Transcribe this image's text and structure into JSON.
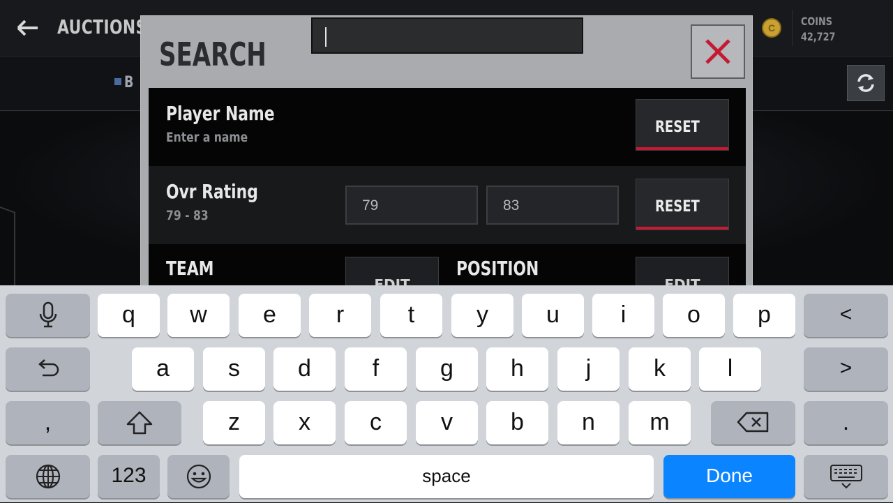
{
  "app": {
    "title": "AUCTIONS",
    "back_icon": "back-arrow-icon",
    "coins_label": "COINS",
    "coins_value": "42,727",
    "coin_icon": "coin-icon",
    "refresh_icon": "refresh-icon",
    "subbar_letter": "B"
  },
  "modal": {
    "title": "SEARCH",
    "search_value": "",
    "close_icon": "close-x-icon",
    "accent_color": "#c41a33",
    "rows": {
      "player_name": {
        "label": "Player Name",
        "sub": "Enter a name",
        "reset": "RESET"
      },
      "ovr_rating": {
        "label": "Ovr Rating",
        "sub": "79 - 83",
        "min": "79",
        "max": "83",
        "reset": "RESET"
      },
      "team": {
        "label": "TEAM",
        "edit": "EDIT"
      },
      "position": {
        "label": "POSITION",
        "edit": "EDIT"
      }
    }
  },
  "keyboard": {
    "row1": [
      "q",
      "w",
      "e",
      "r",
      "t",
      "y",
      "u",
      "i",
      "o",
      "p"
    ],
    "row2": [
      "a",
      "s",
      "d",
      "f",
      "g",
      "h",
      "j",
      "k",
      "l"
    ],
    "row3": [
      "z",
      "x",
      "c",
      "v",
      "b",
      "n",
      "m"
    ],
    "mic_icon": "microphone-icon",
    "left_arrow": "<",
    "right_arrow": ">",
    "undo_icon": "undo-icon",
    "comma": ",",
    "period": ".",
    "shift_icon": "shift-icon",
    "backspace_icon": "backspace-icon",
    "globe_icon": "globe-icon",
    "numbers": "123",
    "emoji_icon": "emoji-icon",
    "space": "space",
    "done": "Done",
    "hide_icon": "keyboard-hide-icon",
    "done_color": "#0a84ff"
  }
}
